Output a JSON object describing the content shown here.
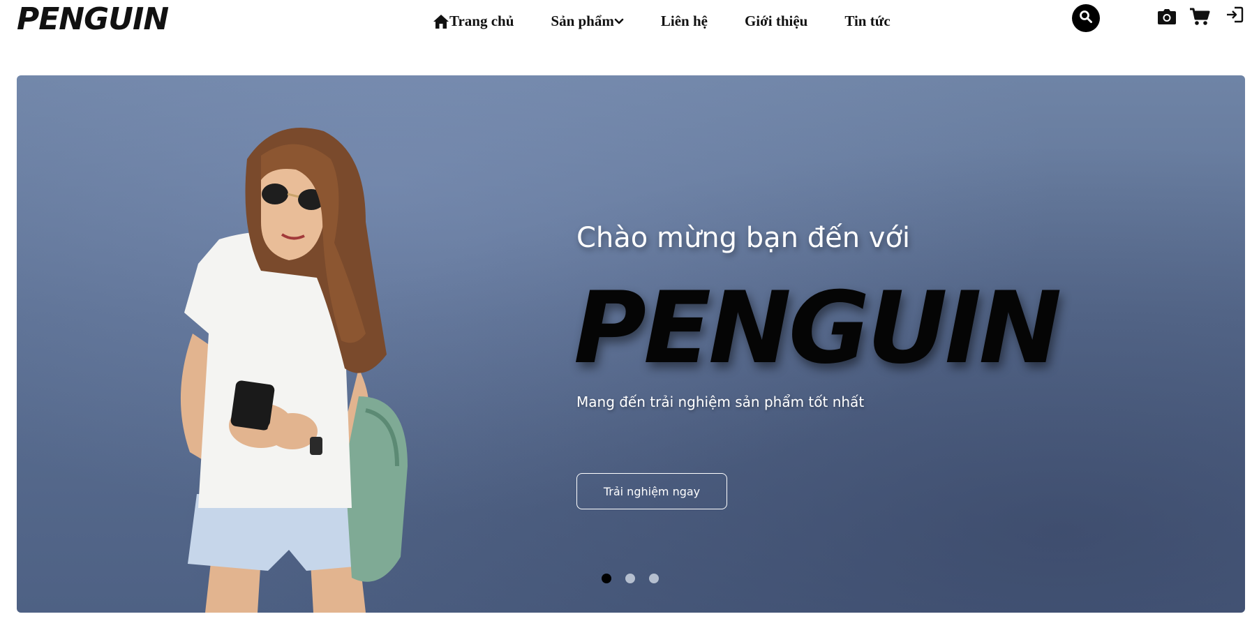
{
  "header": {
    "logo": "PENGUIN",
    "nav": [
      {
        "label": "Trang chủ",
        "icon": "home-icon"
      },
      {
        "label": "Sản phẩm",
        "icon": "chevron-down-icon"
      },
      {
        "label": "Liên hệ"
      },
      {
        "label": "Giới thiệu"
      },
      {
        "label": "Tin tức"
      }
    ],
    "actions": [
      {
        "name": "search-icon"
      },
      {
        "name": "camera-icon"
      },
      {
        "name": "cart-icon"
      },
      {
        "name": "login-icon"
      }
    ]
  },
  "hero": {
    "welcome": "Chào mừng bạn đến với",
    "title": "PENGUIN",
    "subtitle": "Mang đến trải nghiệm sản phẩm tốt nhất",
    "cta": "Trải nghiệm ngay",
    "slides": {
      "count": 3,
      "active": 1
    }
  },
  "colors": {
    "accent": "#000000",
    "hero_bg": "#5b6f92",
    "text_light": "#ffffff"
  }
}
